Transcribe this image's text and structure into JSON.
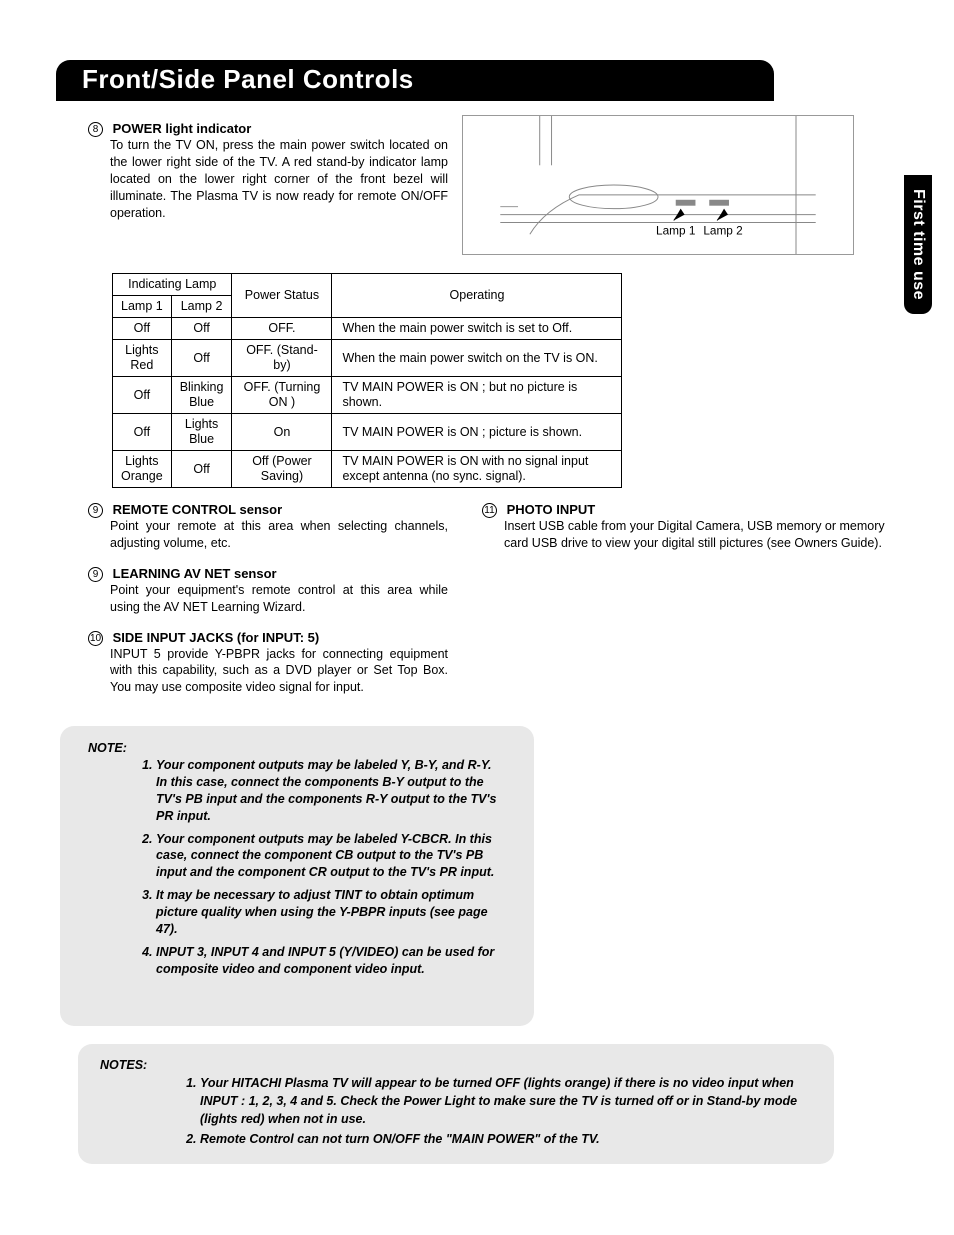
{
  "header": {
    "title": "Front/Side Panel Controls"
  },
  "sidetab": "First time use",
  "sections": {
    "s8": {
      "num": "8",
      "title": "POWER light indicator",
      "body": "To turn the TV ON, press the main power switch located on the lower right side of the TV. A red stand-by indicator lamp located on the lower right corner of the front bezel will illuminate. The Plasma TV is now ready for remote ON/OFF operation."
    },
    "s9a": {
      "num": "9",
      "title": "REMOTE CONTROL sensor",
      "body": "Point your remote at this area when selecting channels, adjusting volume, etc."
    },
    "s9b": {
      "num": "9",
      "title": "LEARNING AV NET sensor",
      "body": "Point your equipment's remote control at this area while using the AV NET Learning Wizard."
    },
    "s10": {
      "num": "10",
      "title_pre": "SIDE INPUT JACKS (for ",
      "title_mid": "INPUT",
      "title_post": ": 5)",
      "body": "INPUT 5 provide Y-PBPR jacks for connecting equipment with this capability, such as a DVD player or Set Top Box. You may use composite video signal for       input."
    },
    "s11": {
      "num": "11",
      "title": "PHOTO INPUT",
      "body": "Insert USB cable from your Digital Camera, USB memory or memory card USB drive to view your digital still pictures (see Owners Guide)."
    }
  },
  "diagram": {
    "lamp1": "Lamp 1",
    "lamp2": "Lamp 2"
  },
  "table": {
    "h_indicating": "Indicating Lamp",
    "h_power": "Power Status",
    "h_operating": "Operating",
    "h_lamp1": "Lamp 1",
    "h_lamp2": "Lamp 2",
    "rows": [
      {
        "l1": "Off",
        "l2": "Off",
        "ps": "OFF.",
        "op": "When the main power switch is set to Off."
      },
      {
        "l1": "Lights Red",
        "l2": "Off",
        "ps": "OFF. (Stand-by)",
        "op": "When the main power switch on the TV is ON."
      },
      {
        "l1": "Off",
        "l2": "Blinking Blue",
        "ps": "OFF. (Turning ON )",
        "op": "TV MAIN POWER is ON ; but no picture is shown."
      },
      {
        "l1": "Off",
        "l2": "Lights Blue",
        "ps": "On",
        "op": "TV MAIN POWER is ON ; picture is shown."
      },
      {
        "l1": "Lights Orange",
        "l2": "Off",
        "ps": "Off (Power Saving)",
        "op": "TV MAIN POWER is ON with no signal input except antenna (no sync. signal)."
      }
    ]
  },
  "note1": {
    "label": "NOTE:",
    "items": [
      "Your component outputs may be labeled Y, B-Y, and R-Y. In this case, connect the components B-Y output to the TV's PB input and the components R-Y output to the TV's PR input.",
      "Your component outputs may be labeled Y-CBCR. In this case, connect the component CB output to the TV's PB input and the component CR output to the TV's PR input.",
      "It may be necessary to adjust TINT to obtain optimum picture quality when using the Y-PBPR inputs (see page 47).",
      "INPUT 3, INPUT 4 and INPUT 5 (Y/VIDEO) can be used for composite video and component video input."
    ]
  },
  "note2": {
    "label": "NOTES:",
    "items": [
      "Your HITACHI Plasma TV will appear to be turned OFF (lights orange) if there is no video input when INPUT : 1, 2, 3, 4 and 5.  Check the Power Light to make sure the TV is turned off or in Stand-by mode (lights red) when not in use.",
      "Remote Control can not turn ON/OFF the \"MAIN  POWER\" of the TV."
    ]
  }
}
